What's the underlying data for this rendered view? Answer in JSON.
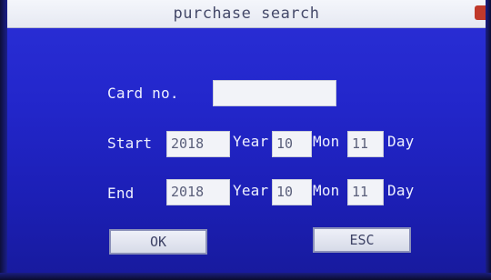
{
  "window": {
    "title": "purchase search"
  },
  "form": {
    "card_label": "Card no.",
    "card_value": "",
    "start_label": "Start",
    "end_label": "End",
    "year_label": "Year",
    "month_label": "Mon",
    "day_label": "Day",
    "start": {
      "year": "2018",
      "month": "10",
      "day": "11"
    },
    "end": {
      "year": "2018",
      "month": "10",
      "day": "11"
    }
  },
  "buttons": {
    "ok_label": "OK",
    "esc_label": "ESC"
  },
  "colors": {
    "background": "#2327cc",
    "title_bar": "#f4f6fb",
    "field": "#f2f3f8",
    "text": "#eef0ff"
  }
}
